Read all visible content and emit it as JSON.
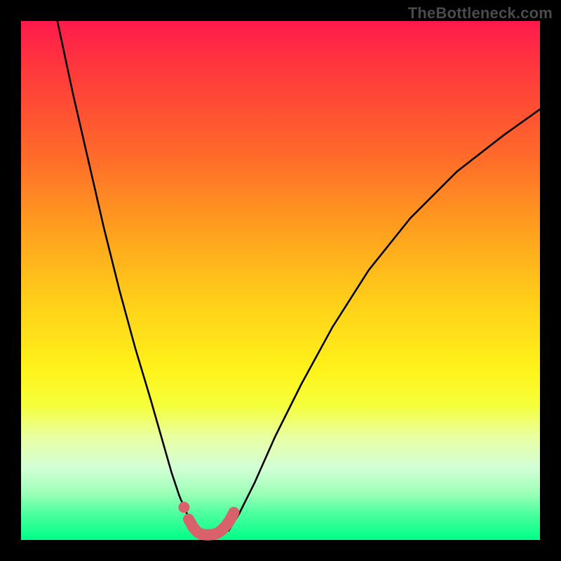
{
  "watermark": "TheBottleneck.com",
  "colors": {
    "curve_black": "#000000",
    "accent_pink": "#d9616c",
    "bg_black": "#000000"
  },
  "chart_data": {
    "type": "line",
    "title": "",
    "xlabel": "",
    "ylabel": "",
    "xlim": [
      0,
      100
    ],
    "ylim": [
      0,
      100
    ],
    "grid": false,
    "legend": false,
    "series": [
      {
        "name": "left-curve",
        "x": [
          7,
          10,
          13,
          16,
          19,
          22,
          25,
          27,
          29,
          30.5,
          32,
          33.5,
          34.5
        ],
        "y": [
          100,
          86,
          73,
          60,
          48,
          37,
          27,
          20,
          13,
          8.5,
          5,
          2.5,
          1.5
        ]
      },
      {
        "name": "right-curve",
        "x": [
          40,
          42,
          45,
          49,
          54,
          60,
          67,
          75,
          84,
          93,
          100
        ],
        "y": [
          1.8,
          5,
          11,
          20,
          30,
          41,
          52,
          62,
          71,
          78,
          83
        ]
      },
      {
        "name": "valley-accent",
        "x": [
          32.3,
          33.2,
          34,
          34.8,
          35.6,
          36.4,
          37.2,
          38,
          38.8,
          39.6,
          40.4,
          41
        ],
        "y": [
          4.0,
          2.4,
          1.5,
          1.1,
          1.0,
          1.0,
          1.1,
          1.4,
          2.0,
          2.9,
          4.1,
          5.3
        ]
      },
      {
        "name": "accent-dot",
        "x": [
          31.4
        ],
        "y": [
          6.3
        ]
      }
    ],
    "annotations": []
  }
}
